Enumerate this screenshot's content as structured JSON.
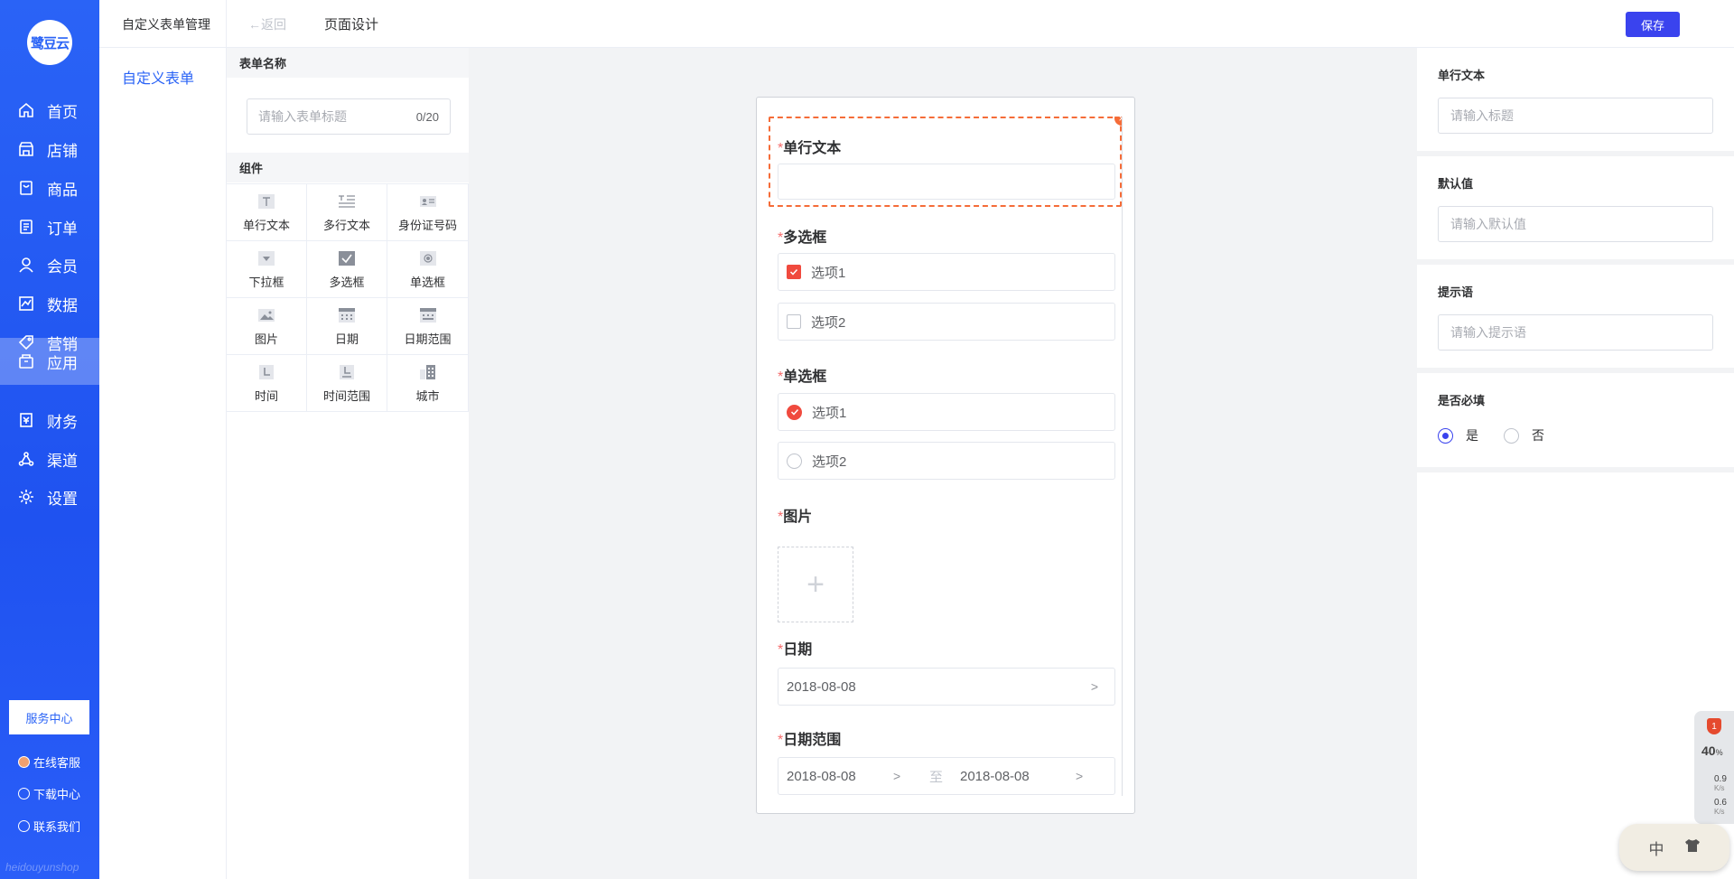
{
  "app": {
    "logo_text": "鹭豆云",
    "watermark": "heidouyunshop"
  },
  "nav": {
    "items": [
      {
        "label": "首页",
        "icon": "home-icon"
      },
      {
        "label": "店铺",
        "icon": "store-icon"
      },
      {
        "label": "商品",
        "icon": "goods-icon"
      },
      {
        "label": "订单",
        "icon": "order-icon"
      },
      {
        "label": "会员",
        "icon": "member-icon"
      },
      {
        "label": "数据",
        "icon": "chart-icon"
      },
      {
        "label": "营销",
        "icon": "tag-icon"
      },
      {
        "label": "应用",
        "icon": "app-icon",
        "active": true
      },
      {
        "label": "财务",
        "icon": "finance-icon"
      },
      {
        "label": "渠道",
        "icon": "channel-icon"
      },
      {
        "label": "设置",
        "icon": "gear-icon"
      }
    ],
    "service_center": "服务中心",
    "online_service": "在线客服",
    "download_center": "下载中心",
    "contact_us": "联系我们"
  },
  "subnav": {
    "title": "自定义表单管理",
    "item": "自定义表单"
  },
  "topbar": {
    "back_label": "返回",
    "page_title": "页面设计",
    "save_label": "保存"
  },
  "component_panel": {
    "form_name_header": "表单名称",
    "form_name_placeholder": "请输入表单标题",
    "form_name_counter": "0/20",
    "components_header": "组件",
    "components": [
      {
        "label": "单行文本",
        "icon": "single-text-icon"
      },
      {
        "label": "多行文本",
        "icon": "multi-text-icon"
      },
      {
        "label": "身份证号码",
        "icon": "id-card-icon"
      },
      {
        "label": "下拉框",
        "icon": "dropdown-icon"
      },
      {
        "label": "多选框",
        "icon": "checkbox-icon"
      },
      {
        "label": "单选框",
        "icon": "radio-icon"
      },
      {
        "label": "图片",
        "icon": "image-icon"
      },
      {
        "label": "日期",
        "icon": "calendar-icon"
      },
      {
        "label": "日期范围",
        "icon": "date-range-icon"
      },
      {
        "label": "时间",
        "icon": "time-icon"
      },
      {
        "label": "时间范围",
        "icon": "time-range-icon"
      },
      {
        "label": "城市",
        "icon": "city-icon"
      }
    ]
  },
  "preview": {
    "required_mark": "*",
    "fields": {
      "single_text": "单行文本",
      "checkbox": "多选框",
      "radio": "单选框",
      "image": "图片",
      "date": "日期",
      "date_range": "日期范围"
    },
    "checkbox_options": [
      "选项1",
      "选项2"
    ],
    "radio_options": [
      "选项1",
      "选项2"
    ],
    "upload_plus": "+",
    "date_value": "2018-08-08",
    "range_start": "2018-08-08",
    "range_sep": "至",
    "range_end": "2018-08-08",
    "close_glyph": "×"
  },
  "properties": {
    "title_label": "单行文本",
    "title_placeholder": "请输入标题",
    "default_label": "默认值",
    "default_placeholder": "请输入默认值",
    "hint_label": "提示语",
    "hint_placeholder": "请输入提示语",
    "required_label": "是否必填",
    "required_yes": "是",
    "required_no": "否",
    "required_selected": "是"
  },
  "tray": {
    "badge": "1",
    "percent": "40",
    "percent_unit": "%",
    "upload_speed": "0.9",
    "download_speed": "0.6",
    "speed_unit": "K/s",
    "ime_lang": "中"
  },
  "colors": {
    "nav_bg": "#2a63f6",
    "accent": "#3a43ee",
    "required": "#f56c6c",
    "selected_outline": "#f56c38",
    "checked": "#f04a3e"
  }
}
